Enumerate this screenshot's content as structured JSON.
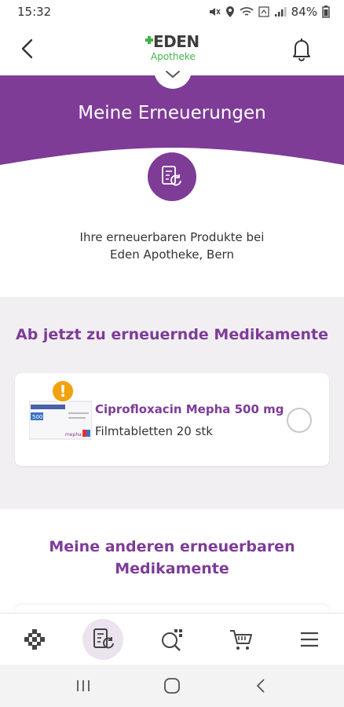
{
  "status_bar": {
    "time": "15:32",
    "battery": "84%"
  },
  "header": {
    "logo_brand": "EDEN",
    "logo_sub": "Apotheke"
  },
  "banner": {
    "title": "Meine Erneuerungen"
  },
  "intro": {
    "line1": "Ihre erneuerbaren Produkte bei",
    "line2": "Eden Apotheke, Bern"
  },
  "due_section": {
    "title": "Ab jetzt zu erneuernde Medikamente",
    "items": [
      {
        "name": "Ciprofloxacin Mepha 500 mg",
        "description": "Filmtabletten 20 stk",
        "warning": "!",
        "box_label": "500",
        "box_brand": "mepha"
      }
    ]
  },
  "other_section": {
    "title_line1": "Meine anderen erneuerbaren",
    "title_line2": "Medikamente"
  },
  "colors": {
    "primary_purple": "#7e3c97",
    "brand_green": "#3fb34a",
    "warning_orange": "#f2a20a",
    "section_bg": "#f2eff3"
  },
  "bottom_nav": {
    "items": [
      "home-icon",
      "renewals-icon",
      "search-icon",
      "cart-icon",
      "menu-icon"
    ],
    "active": "renewals-icon"
  }
}
